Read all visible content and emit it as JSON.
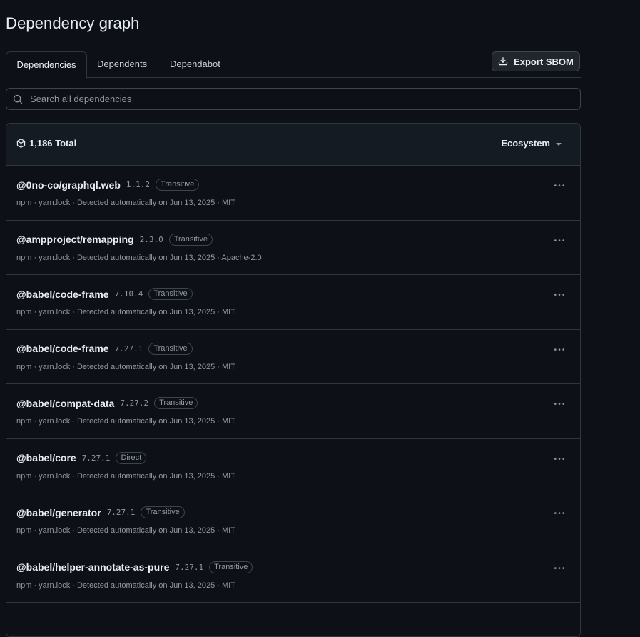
{
  "page": {
    "title": "Dependency graph"
  },
  "tabs": [
    {
      "label": "Dependencies",
      "selected": true
    },
    {
      "label": "Dependents",
      "selected": false
    },
    {
      "label": "Dependabot",
      "selected": false
    }
  ],
  "toolbar": {
    "export_label": "Export SBOM"
  },
  "search": {
    "placeholder": "Search all dependencies",
    "value": ""
  },
  "summary": {
    "total_label": "1,186 Total",
    "ecosystem_label": "Ecosystem"
  },
  "dependencies": [
    {
      "name": "@0no-co/graphql.web",
      "version": "1.1.2",
      "badge": "Transitive",
      "meta": "npm · yarn.lock · Detected automatically on Jun 13, 2025 · MIT"
    },
    {
      "name": "@ampproject/remapping",
      "version": "2.3.0",
      "badge": "Transitive",
      "meta": "npm · yarn.lock · Detected automatically on Jun 13, 2025 · Apache-2.0"
    },
    {
      "name": "@babel/code-frame",
      "version": "7.10.4",
      "badge": "Transitive",
      "meta": "npm · yarn.lock · Detected automatically on Jun 13, 2025 · MIT"
    },
    {
      "name": "@babel/code-frame",
      "version": "7.27.1",
      "badge": "Transitive",
      "meta": "npm · yarn.lock · Detected automatically on Jun 13, 2025 · MIT"
    },
    {
      "name": "@babel/compat-data",
      "version": "7.27.2",
      "badge": "Transitive",
      "meta": "npm · yarn.lock · Detected automatically on Jun 13, 2025 · MIT"
    },
    {
      "name": "@babel/core",
      "version": "7.27.1",
      "badge": "Direct",
      "meta": "npm · yarn.lock · Detected automatically on Jun 13, 2025 · MIT"
    },
    {
      "name": "@babel/generator",
      "version": "7.27.1",
      "badge": "Transitive",
      "meta": "npm · yarn.lock · Detected automatically on Jun 13, 2025 · MIT"
    },
    {
      "name": "@babel/helper-annotate-as-pure",
      "version": "7.27.1",
      "badge": "Transitive",
      "meta": "npm · yarn.lock · Detected automatically on Jun 13, 2025 · MIT"
    }
  ],
  "icons": {
    "download": "download-icon",
    "search": "search-icon",
    "package": "package-icon",
    "kebab": "kebab-horizontal-icon"
  },
  "colors": {
    "background": "#0d1117",
    "border": "#30363d",
    "text": "#e6edf3",
    "muted": "#9198a1",
    "header_bg": "#151b23"
  }
}
